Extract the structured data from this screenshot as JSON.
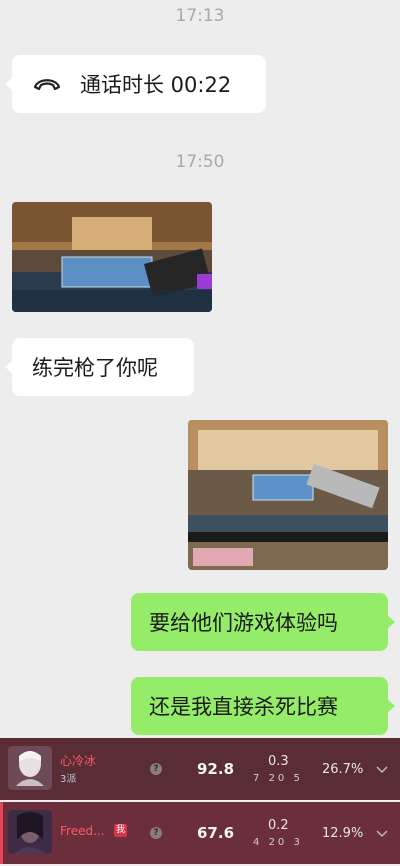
{
  "chat": {
    "time1": "17:13",
    "call": {
      "label": "通话时长 00:22",
      "icon": "phone-hangup-icon"
    },
    "time2": "17:50",
    "msg_in_1": "练完枪了你呢",
    "msg_out_1": "要给他们游戏体验吗",
    "msg_out_2": "还是我直接杀死比赛"
  },
  "scoreboard": {
    "rows": [
      {
        "name": "心冷冰",
        "rank": "3派",
        "score": "92.8",
        "ratio": "0.3",
        "k": "7",
        "d": "20",
        "a": "5",
        "pct": "26.7%",
        "me": ""
      },
      {
        "name": "Freed...",
        "rank": "",
        "score": "67.6",
        "ratio": "0.2",
        "k": "4",
        "d": "20",
        "a": "3",
        "pct": "12.9%",
        "me": "我"
      }
    ],
    "help_icon": "?"
  },
  "colors": {
    "outgoing": "#95ec69",
    "incoming": "#ffffff",
    "background": "#ededed"
  }
}
